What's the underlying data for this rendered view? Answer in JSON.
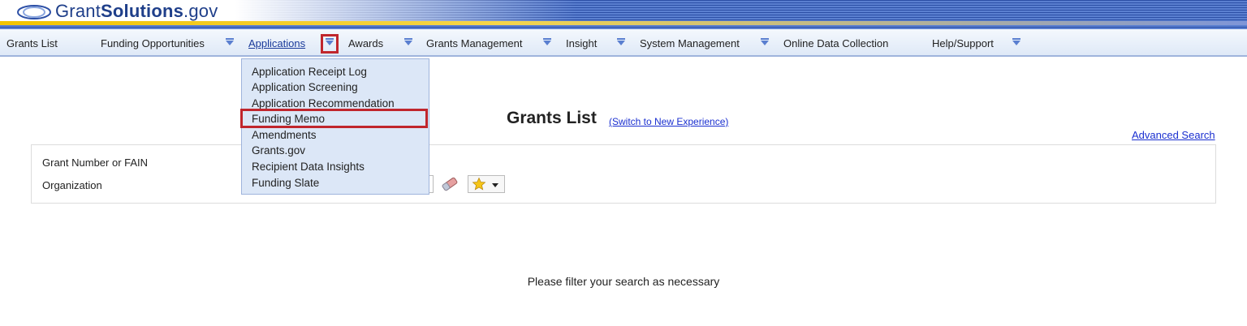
{
  "header": {
    "logo_prefix": "Grant",
    "logo_bold": "Solutions",
    "logo_suffix": ".gov"
  },
  "nav": {
    "items": [
      {
        "label": "Grants List"
      },
      {
        "label": "Funding Opportunities"
      },
      {
        "label": "Applications"
      },
      {
        "label": "Awards"
      },
      {
        "label": "Grants Management"
      },
      {
        "label": "Insight"
      },
      {
        "label": "System Management"
      },
      {
        "label": "Online Data Collection"
      },
      {
        "label": "Help/Support"
      }
    ]
  },
  "applications_menu": {
    "items": [
      "Application Receipt Log",
      "Application Screening",
      "Application Recommendation",
      "Funding Memo",
      "Amendments",
      "Grants.gov",
      "Recipient Data Insights",
      "Funding Slate"
    ]
  },
  "main": {
    "title": "Grants List",
    "switch_link": "(Switch to New Experience)",
    "advanced_search": "Advanced Search",
    "filter": {
      "grant_number_label": "Grant Number or FAIN",
      "organization_label": "Organization"
    },
    "empty_message": "Please filter your search as necessary"
  },
  "colors": {
    "highlight": "#c0262d",
    "link": "#1a2fd0",
    "brand_blue": "#1f3f8a",
    "menu_bg": "#dce7f7"
  },
  "icons": {
    "logo": "ellipse-logo-icon",
    "nav_arrow": "chevron-down-icon",
    "eraser": "eraser-icon",
    "favorites": "star-icon"
  }
}
